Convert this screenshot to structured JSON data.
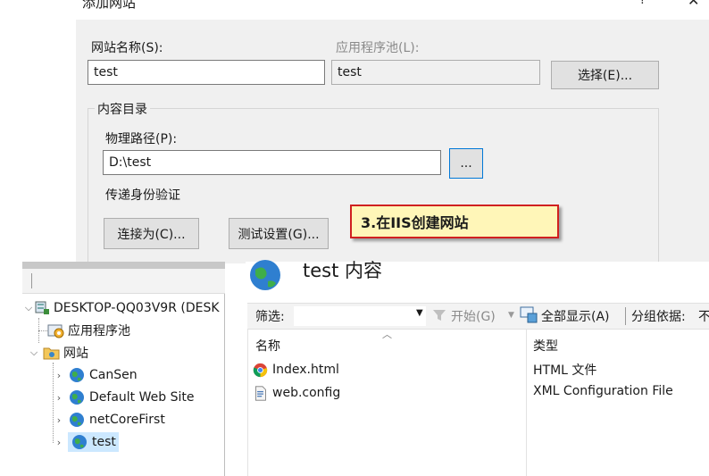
{
  "dialog": {
    "title": "添加网站",
    "help_glyph": "?",
    "close_glyph": "✕",
    "site_name_label": "网站名称(S):",
    "site_name_value": "test",
    "app_pool_label": "应用程序池(L):",
    "app_pool_value": "test",
    "select_button": "选择(E)...",
    "content_dir_group": "内容目录",
    "physical_path_label": "物理路径(P):",
    "physical_path_value": "D:\\test",
    "browse_button": "...",
    "pass_auth_label": "传递身份验证",
    "connect_as_button": "连接为(C)...",
    "test_settings_button": "测试设置(G)..."
  },
  "callout": {
    "text": "3.在IIS创建网站"
  },
  "tree": {
    "root": "DESKTOP-QQ03V9R (DESK",
    "app_pools": "应用程序池",
    "sites": "网站",
    "site_items": [
      "CanSen",
      "Default Web Site",
      "netCoreFirst",
      "test"
    ],
    "selected": "test"
  },
  "content": {
    "heading": "test 内容",
    "filter_label": "筛选:",
    "start_button": "开始(G)",
    "show_all_button": "全部显示(A)",
    "group_by_label": "分组依据:",
    "group_by_value": "不",
    "columns": [
      "名称",
      "类型"
    ],
    "files": [
      {
        "name": "Index.html",
        "type": "HTML 文件",
        "icon": "chrome-icon"
      },
      {
        "name": "web.config",
        "type": "XML Configuration File",
        "icon": "config-file-icon"
      }
    ]
  },
  "colors": {
    "accent": "#0078d7",
    "callout_bg": "#fff6b8",
    "callout_border": "#d02020",
    "selection": "#cce8ff"
  }
}
